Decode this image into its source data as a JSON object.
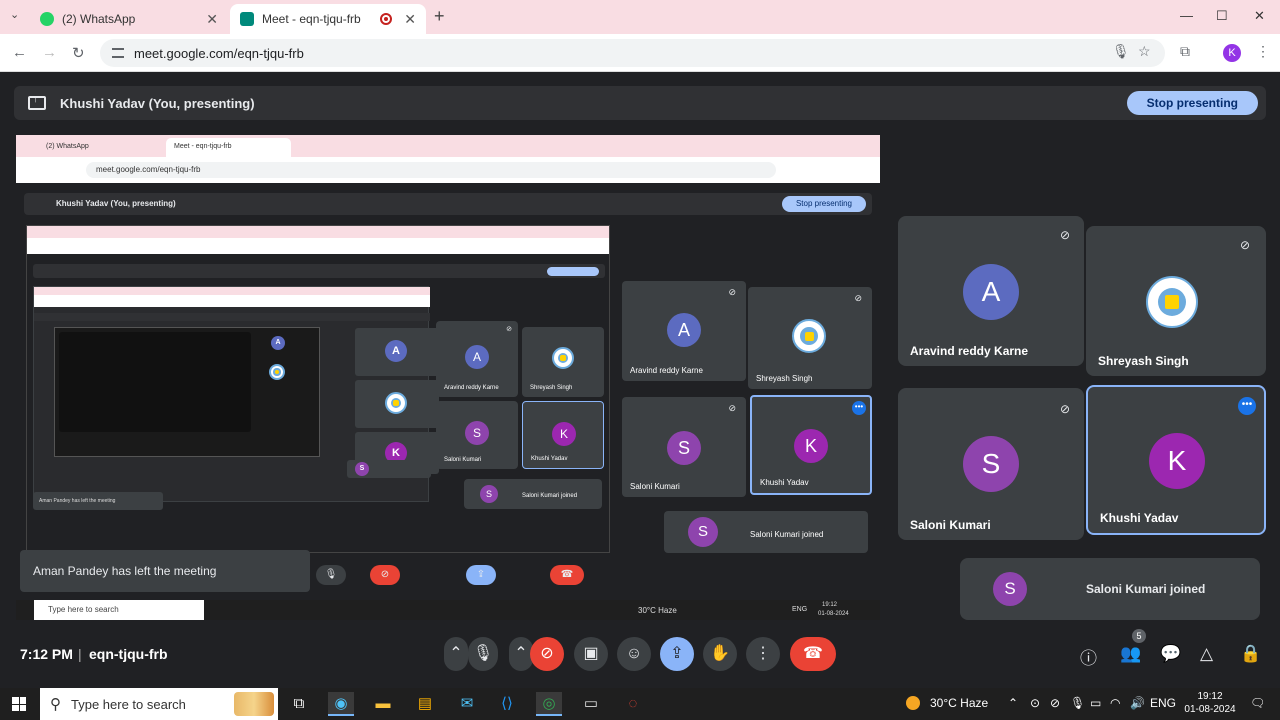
{
  "browser": {
    "tabs": [
      {
        "label": "(2) WhatsApp",
        "fav_color": "#25d366"
      },
      {
        "label": "Meet - eqn-tjqu-frb",
        "fav_color": "#00897b"
      }
    ],
    "url": "meet.google.com/eqn-tjqu-frb",
    "profile_initial": "K"
  },
  "meet": {
    "presenting_label": "Khushi Yadav (You, presenting)",
    "stop_presenting": "Stop presenting",
    "time": "7:12 PM",
    "separator": "|",
    "meeting_code": "eqn-tjqu-frb",
    "people_count": "5"
  },
  "participants": [
    {
      "name": "Aravind reddy Karne",
      "initial": "A",
      "color": "#5c6bc0",
      "muted": true
    },
    {
      "name": "Shreyash Singh",
      "initial": "",
      "avatar": "manchester-city-crest",
      "muted": true
    },
    {
      "name": "Saloni Kumari",
      "initial": "S",
      "color": "#8e44ad",
      "muted": true
    },
    {
      "name": "Khushi Yadav",
      "initial": "K",
      "color": "#9c27b0",
      "muted": false
    }
  ],
  "join_notice": {
    "initial": "S",
    "text": "Saloni Kumari joined"
  },
  "shared": {
    "tabs": [
      "(2) WhatsApp",
      "Meet - eqn-tjqu-frb"
    ],
    "url": "meet.google.com/eqn-tjqu-frb",
    "presenting_label": "Khushi Yadav (You, presenting)",
    "stop_presenting": "Stop presenting",
    "notification": "Aman Pandey has left the meeting",
    "participants": [
      "Aravind reddy Karne",
      "Shreyash Singh",
      "Saloni Kumari",
      "Khushi Yadav"
    ],
    "joined": "Saloni Kumari joined",
    "nested_notification": "Aman Pandey has left the meeting",
    "taskbar_search": "Type here to search",
    "weather": "30°C Haze",
    "lang": "ENG",
    "clock_time": "19:12",
    "clock_date": "01-08-2024"
  },
  "taskbar": {
    "search_placeholder": "Type here to search",
    "weather": "30°C Haze",
    "lang": "ENG",
    "time": "19:12",
    "date": "01-08-2024"
  }
}
